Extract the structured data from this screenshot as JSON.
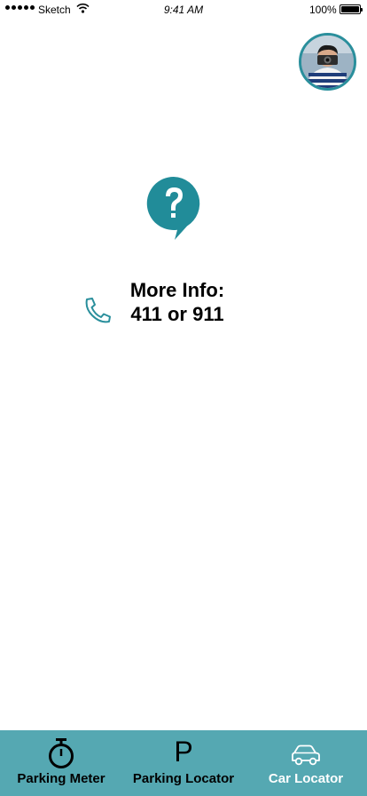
{
  "status_bar": {
    "carrier": "Sketch",
    "time": "9:41 AM",
    "battery": "100%"
  },
  "profile": {
    "avatar_icon": "user-avatar"
  },
  "help": {
    "icon": "question-bubble-icon",
    "color": "#218c99"
  },
  "info": {
    "title": "More Info:",
    "numbers": "411 or 911",
    "phone_icon": "phone-icon"
  },
  "tab_bar": {
    "background": "#55a8b2",
    "tabs": [
      {
        "label": "Parking Meter",
        "icon": "stopwatch-icon",
        "active": false
      },
      {
        "label": "Parking Locator",
        "icon": "parking-p-icon",
        "glyph": "P",
        "active": false
      },
      {
        "label": "Car Locator",
        "icon": "car-icon",
        "active": true
      }
    ]
  }
}
